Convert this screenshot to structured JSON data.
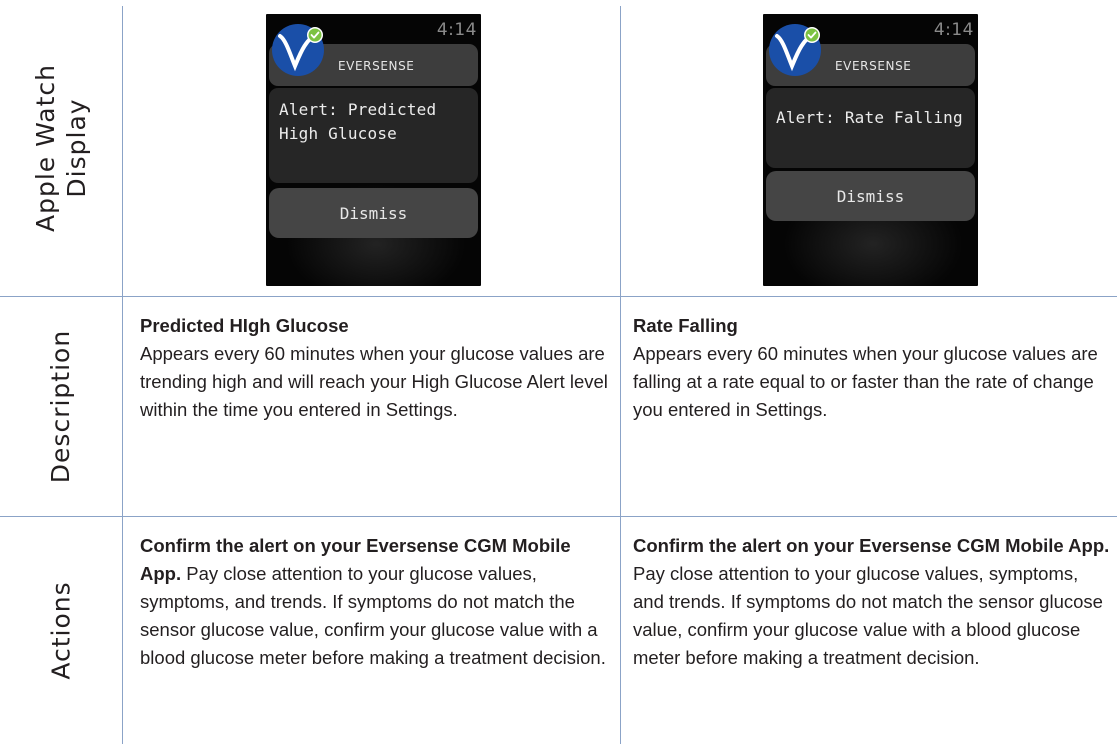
{
  "row_labels": {
    "display": "Apple Watch\nDisplay",
    "description": "Description",
    "actions": "Actions"
  },
  "left": {
    "watch": {
      "time": "4:14",
      "brand": "EVERSENSE",
      "alert": "Alert:  Predicted High Glucose",
      "alert_line1": "Alert:  Predicted",
      "alert_line2": "High Glucose",
      "dismiss": "Dismiss"
    },
    "description_title": "Predicted HIgh Glucose",
    "description_body": "Appears every 60 minutes when your glucose values are trending high and will reach your High Glucose Alert level within the time you entered in Settings.",
    "actions_bold": "Confirm the alert on your Eversense CGM Mobile App.",
    "actions_body": " Pay close attention to your glucose values, symptoms, and trends. If symptoms do not match the sensor glucose value, confirm your glucose value with a blood glucose meter before making a treatment decision."
  },
  "right": {
    "watch": {
      "time": "4:14",
      "brand": "EVERSENSE",
      "alert": "Alert:  Rate Falling",
      "dismiss": "Dismiss"
    },
    "description_title": "Rate Falling",
    "description_body": "Appears every 60 minutes when your glucose values are falling at a rate equal to or faster than the rate of change you entered in Settings.",
    "actions_bold": "Confirm the alert on your Eversense CGM Mobile App.",
    "actions_body": " Pay close attention to your glucose values, symptoms, and trends. If symptoms do not match the sensor glucose value, confirm your glucose value with a blood glucose meter before making a treatment decision."
  },
  "colors": {
    "grid_line": "#8ba3c7",
    "logo_blue": "#1a4fa8",
    "logo_check": "#7cc242"
  }
}
